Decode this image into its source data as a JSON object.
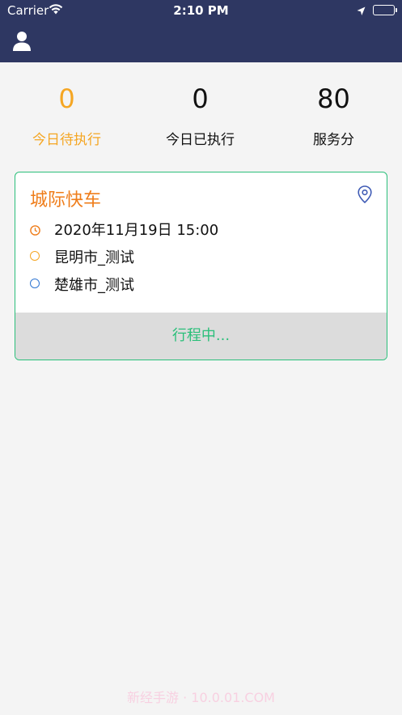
{
  "status_bar": {
    "carrier": "Carrier",
    "time": "2:10 PM"
  },
  "icons": {
    "wifi": "wifi-icon",
    "location": "location-arrow-icon",
    "battery": "battery-icon",
    "avatar": "user-icon",
    "pin": "map-pin-icon",
    "clock": "clock-icon"
  },
  "stats": [
    {
      "value": "0",
      "label": "今日待执行"
    },
    {
      "value": "0",
      "label": "今日已执行"
    },
    {
      "value": "80",
      "label": "服务分"
    }
  ],
  "trip_card": {
    "title": "城际快车",
    "datetime": "2020年11月19日 15:00",
    "origin": "昆明市_测试",
    "destination": "楚雄市_测试",
    "status": "行程中..."
  },
  "colors": {
    "header": "#2e3762",
    "accent_orange": "#f5a623",
    "title_orange": "#ef7d1a",
    "green": "#2bbf7a",
    "blue": "#2f76d2"
  },
  "watermark": "新经手游 · 10.0.01.COM"
}
